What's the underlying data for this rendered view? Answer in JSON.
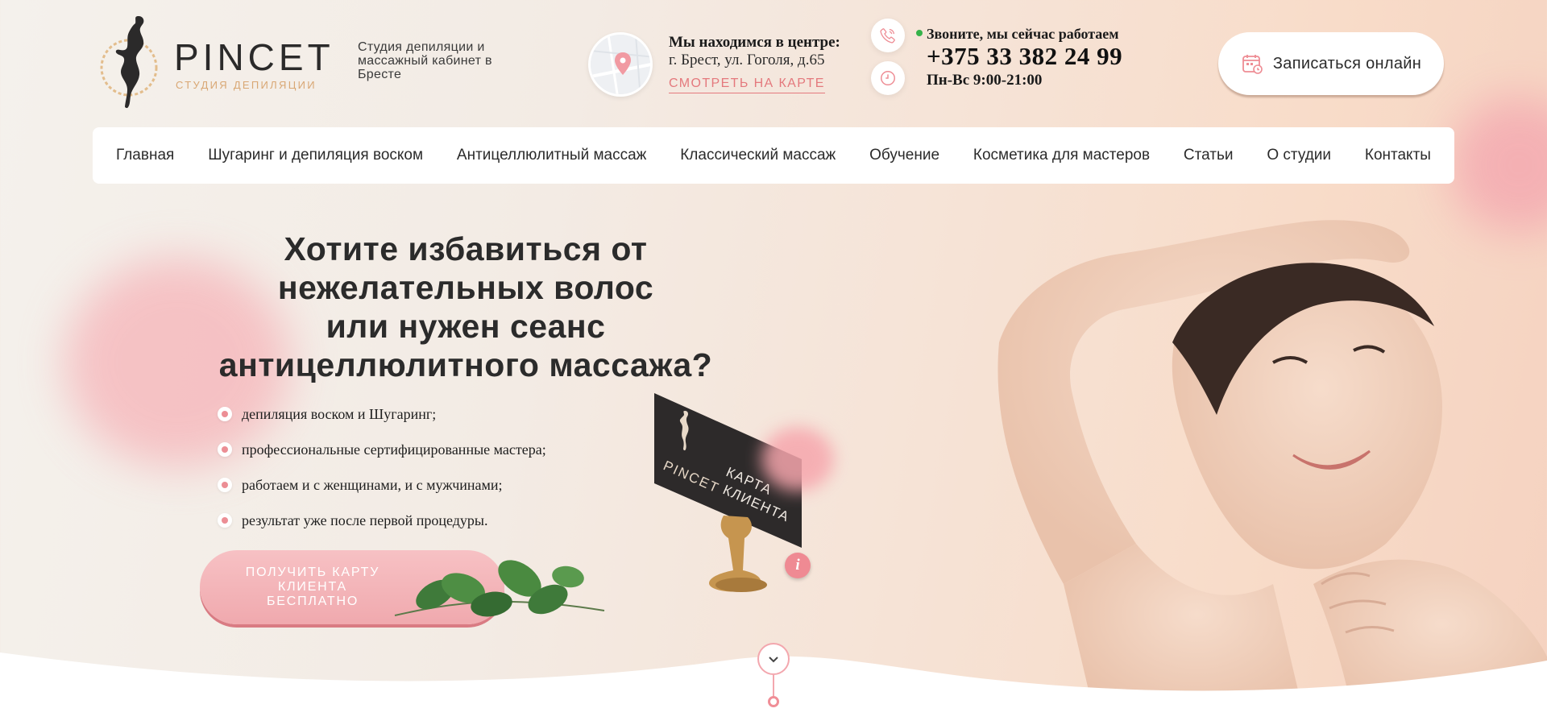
{
  "brand": {
    "name": "PINCET",
    "subtitle": "студия депиляции",
    "tagline": "Студия депиляции и массажный кабинет в Бресте"
  },
  "location": {
    "title": "Мы находимся в центре:",
    "address": "г. Брест, ул. Гоголя, д.65",
    "map_link": "СМОТРЕТЬ НА КАРТЕ"
  },
  "contact": {
    "status": "Звоните, мы сейчас работаем",
    "phone": "+375 33 382 24 99",
    "hours": "Пн-Вс 9:00-21:00"
  },
  "booking": {
    "label": "Записаться онлайн"
  },
  "nav": {
    "items": [
      "Главная",
      "Шугаринг и депиляция воском",
      "Антицеллюлитный массаж",
      "Классический массаж",
      "Обучение",
      "Косметика для мастеров",
      "Статьи",
      "О студии",
      "Контакты"
    ]
  },
  "hero": {
    "line1": "Хотите избавиться от",
    "line2": "нежелательных волос",
    "line3": "или нужен сеанс",
    "line4": "антицеллюлитного массажа?",
    "features": [
      "депиляция воском и Шугаринг;",
      "профессиональные сертифицированные мастера;",
      "работаем и с женщинами, и с мужчинами;",
      "результат уже после первой процедуры."
    ],
    "cta": "ПОЛУЧИТЬ КАРТУ КЛИЕНТА БЕСПЛАТНО",
    "card_brand": "PINCET",
    "card_line1": "КАРТА",
    "card_line2": "КЛИЕНТА",
    "info": "i"
  },
  "colors": {
    "accent": "#ec8e95",
    "link": "#e4797d",
    "gold": "#d9a774",
    "status_green": "#36b24a"
  }
}
